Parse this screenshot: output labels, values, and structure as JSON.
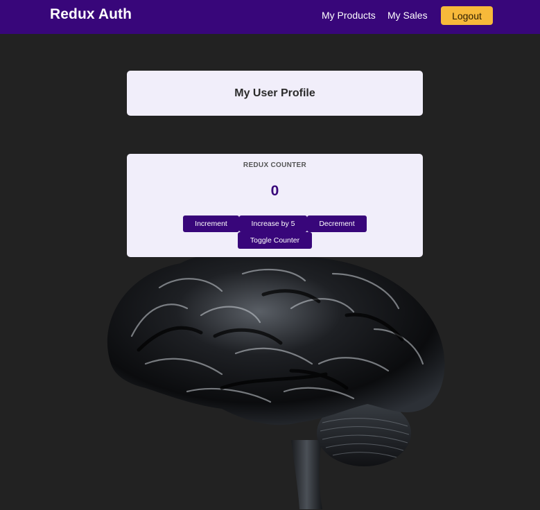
{
  "header": {
    "logo": "Redux Auth",
    "nav": {
      "products": "My Products",
      "sales": "My Sales",
      "logout": "Logout"
    }
  },
  "profile": {
    "title": "My User Profile"
  },
  "counter": {
    "heading": "REDUX COUNTER",
    "value": "0",
    "buttons": {
      "increment": "Increment",
      "increase_by_5": "Increase by 5",
      "decrement": "Decrement",
      "toggle": "Toggle Counter"
    }
  },
  "colors": {
    "header_bg": "#38067a",
    "page_bg": "#222222",
    "card_bg": "#f1eefa",
    "logout_bg": "#f7b93a",
    "accent": "#38067a"
  },
  "background_image": "brain-illustration"
}
